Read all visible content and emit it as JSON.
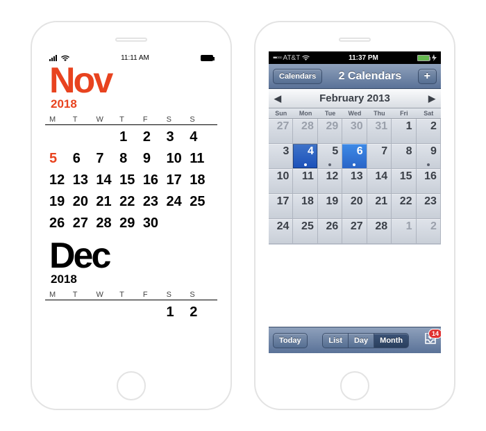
{
  "phone1": {
    "status": {
      "time": "11:11 AM"
    },
    "dow": [
      "M",
      "T",
      "W",
      "T",
      "F",
      "S",
      "S"
    ],
    "months": [
      {
        "label": "Nov",
        "year": "2018",
        "color": "nov",
        "today_value": "5",
        "cells": [
          "",
          "",
          "",
          "1",
          "2",
          "3",
          "4",
          "5",
          "6",
          "7",
          "8",
          "9",
          "10",
          "11",
          "12",
          "13",
          "14",
          "15",
          "16",
          "17",
          "18",
          "19",
          "20",
          "21",
          "22",
          "23",
          "24",
          "25",
          "26",
          "27",
          "28",
          "29",
          "30",
          "",
          ""
        ]
      },
      {
        "label": "Dec",
        "year": "2018",
        "color": "dec",
        "today_value": "",
        "cells": [
          "",
          "",
          "",
          "",
          "",
          "1",
          "2"
        ]
      }
    ]
  },
  "phone2": {
    "status": {
      "carrier": "AT&T",
      "time": "11:37 PM"
    },
    "nav": {
      "back_label": "Calendars",
      "title": "2 Calendars",
      "add_label": "+"
    },
    "month_header": "February 2013",
    "dow": [
      "Sun",
      "Mon",
      "Tue",
      "Wed",
      "Thu",
      "Fri",
      "Sat"
    ],
    "selected_value": "4",
    "today_value": "6",
    "event_dots": [
      "4",
      "5",
      "6",
      "9"
    ],
    "rows": [
      [
        {
          "n": "27",
          "dim": true
        },
        {
          "n": "28",
          "dim": true
        },
        {
          "n": "29",
          "dim": true
        },
        {
          "n": "30",
          "dim": true
        },
        {
          "n": "31",
          "dim": true
        },
        {
          "n": "1"
        },
        {
          "n": "2"
        }
      ],
      [
        {
          "n": "3"
        },
        {
          "n": "4"
        },
        {
          "n": "5"
        },
        {
          "n": "6"
        },
        {
          "n": "7"
        },
        {
          "n": "8"
        },
        {
          "n": "9"
        }
      ],
      [
        {
          "n": "10"
        },
        {
          "n": "11"
        },
        {
          "n": "12"
        },
        {
          "n": "13"
        },
        {
          "n": "14"
        },
        {
          "n": "15"
        },
        {
          "n": "16"
        }
      ],
      [
        {
          "n": "17"
        },
        {
          "n": "18"
        },
        {
          "n": "19"
        },
        {
          "n": "20"
        },
        {
          "n": "21"
        },
        {
          "n": "22"
        },
        {
          "n": "23"
        }
      ],
      [
        {
          "n": "24"
        },
        {
          "n": "25"
        },
        {
          "n": "26"
        },
        {
          "n": "27"
        },
        {
          "n": "28"
        },
        {
          "n": "1",
          "dim": true
        },
        {
          "n": "2",
          "dim": true
        }
      ]
    ],
    "toolbar": {
      "today": "Today",
      "segments": [
        "List",
        "Day",
        "Month"
      ],
      "active_segment": "Month",
      "badge": "14"
    }
  }
}
